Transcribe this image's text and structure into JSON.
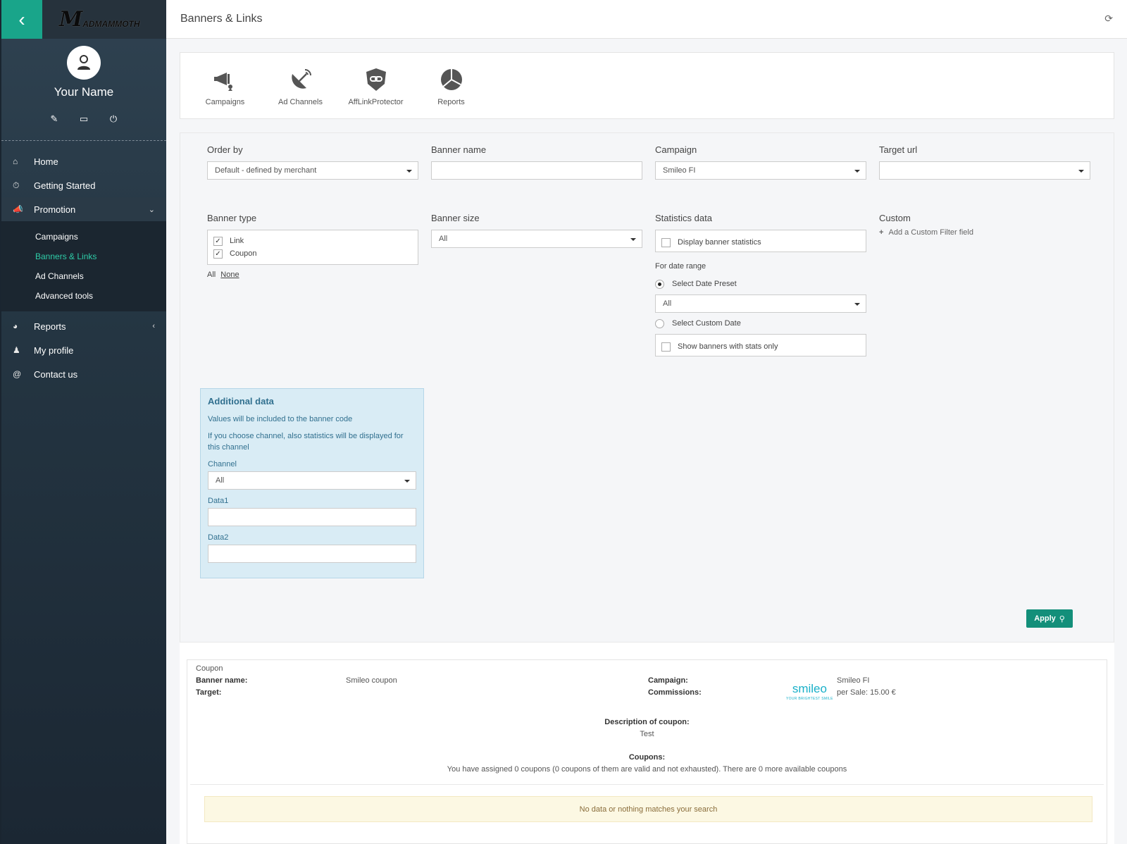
{
  "app": {
    "brand": "ADMAMMOTH",
    "brand_mark": "M",
    "user_name": "Your Name"
  },
  "sidebar": {
    "items": [
      {
        "label": "Home",
        "icon": "home-icon"
      },
      {
        "label": "Getting Started",
        "icon": "stopwatch-icon"
      },
      {
        "label": "Promotion",
        "icon": "megaphone-icon"
      },
      {
        "label": "Reports",
        "icon": "pie-chart-icon"
      },
      {
        "label": "My profile",
        "icon": "user-icon"
      },
      {
        "label": "Contact us",
        "icon": "at-icon"
      }
    ],
    "promotion_sub": [
      "Campaigns",
      "Banners & Links",
      "Ad Channels",
      "Advanced tools"
    ],
    "active_sub": "Banners & Links",
    "accent": "#19a58a"
  },
  "header": {
    "title": "Banners & Links"
  },
  "toolbar": {
    "items": [
      {
        "label": "Campaigns",
        "icon": "megaphone-icon"
      },
      {
        "label": "Ad Channels",
        "icon": "satellite-dish-icon"
      },
      {
        "label": "AffLinkProtector",
        "icon": "shield-link-icon"
      },
      {
        "label": "Reports",
        "icon": "pie-chart-icon"
      }
    ]
  },
  "filters": {
    "order_by": {
      "label": "Order by",
      "value": "Default - defined by merchant"
    },
    "banner_name": {
      "label": "Banner name",
      "value": ""
    },
    "campaign": {
      "label": "Campaign",
      "value": "Smileo FI"
    },
    "target_url": {
      "label": "Target url",
      "value": ""
    },
    "banner_type": {
      "label": "Banner type",
      "options": [
        {
          "label": "Link",
          "checked": true
        },
        {
          "label": "Coupon",
          "checked": true
        }
      ],
      "all": "All",
      "none": "None"
    },
    "banner_size": {
      "label": "Banner size",
      "value": "All"
    },
    "statistics": {
      "label": "Statistics data",
      "display_stats": "Display banner statistics",
      "for_date_range": "For date range",
      "select_preset": "Select Date Preset",
      "preset_value": "All",
      "select_custom": "Select Custom Date",
      "stats_only": "Show banners with stats only"
    },
    "custom": {
      "label": "Custom",
      "add": "Add a Custom Filter field"
    },
    "additional": {
      "title": "Additional data",
      "note1": "Values will be included to the banner code",
      "note2": "If you choose channel, also statistics will be displayed for this channel",
      "channel_label": "Channel",
      "channel_value": "All",
      "data1_label": "Data1",
      "data2_label": "Data2"
    },
    "apply": "Apply"
  },
  "result": {
    "type": "Coupon",
    "banner_name_label": "Banner name:",
    "banner_name": "Smileo coupon",
    "target_label": "Target:",
    "campaign_label": "Campaign:",
    "campaign_name": "Smileo FI",
    "commissions_label": "Commissions:",
    "commission": "per Sale: 15.00 €",
    "logo_text": "smileo",
    "logo_tagline": "YOUR BRIGHTEST SMILE",
    "description_label": "Description of coupon:",
    "description": "Test",
    "coupons_label": "Coupons:",
    "coupons_text": "You have assigned 0 coupons (0 coupons of them are valid and not exhausted). There are 0 more available coupons",
    "no_data": "No data or nothing matches your search"
  }
}
